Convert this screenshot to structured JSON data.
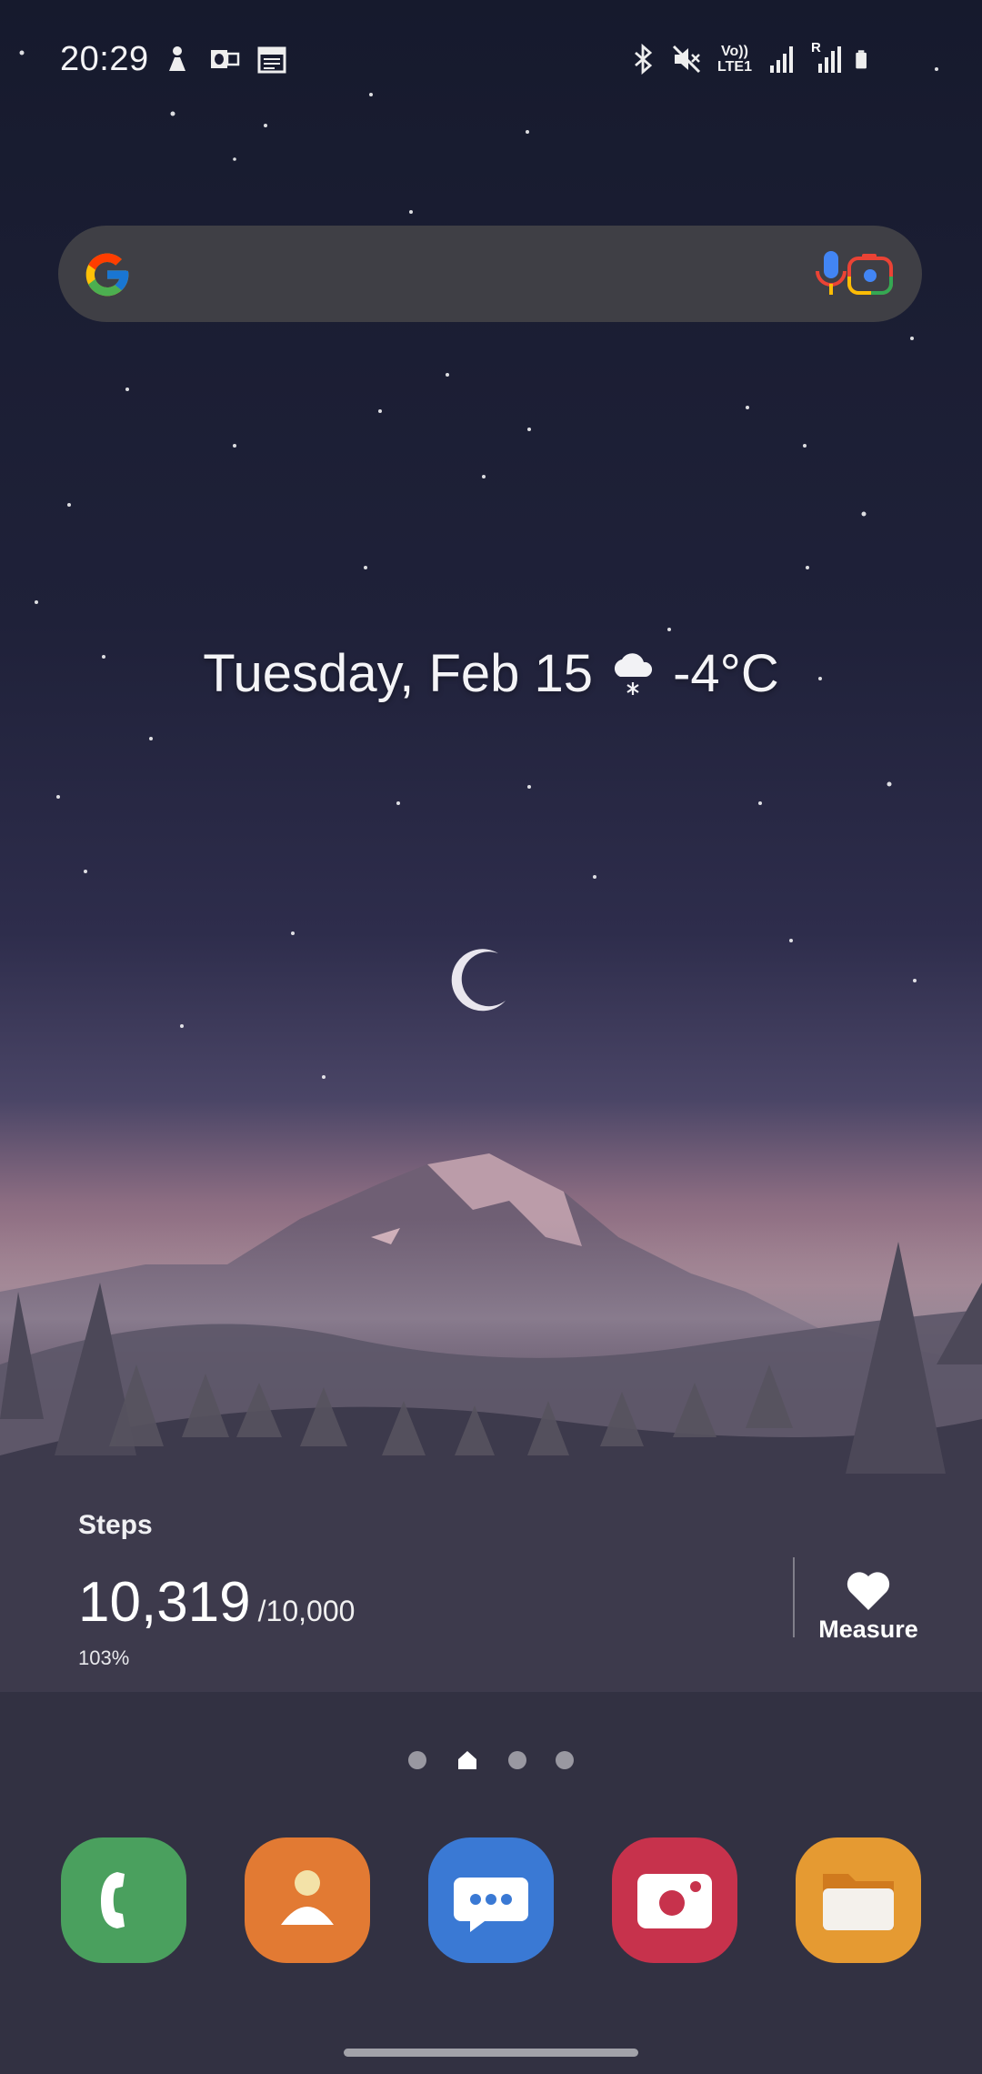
{
  "status_bar": {
    "time": "20:29",
    "left_icons": [
      "notification-person-icon",
      "outlook-icon",
      "calendar-icon"
    ],
    "right_icons": [
      "bluetooth-icon",
      "mute-icon",
      "volte-icon",
      "signal-icon",
      "roaming-signal-icon",
      "battery-icon"
    ],
    "volte_label": "Vo))",
    "lte_label": "LTE1",
    "roaming_label": "R"
  },
  "search": {
    "placeholder": ""
  },
  "date_widget": {
    "date": "Tuesday, Feb 15",
    "weather_icon": "snow-cloud-icon",
    "temperature": "-4°C"
  },
  "steps_widget": {
    "title": "Steps",
    "count": "10,319",
    "goal": "/10,000",
    "percent": "103%",
    "progress_fraction": 1.03,
    "measure_label": "Measure"
  },
  "page_indicator": {
    "pages": 4,
    "current": 2
  },
  "dock": [
    {
      "name": "phone",
      "icon": "phone-icon",
      "color": "#4aa05e"
    },
    {
      "name": "contacts",
      "icon": "contacts-icon",
      "color": "#e27a33"
    },
    {
      "name": "messages",
      "icon": "messages-icon",
      "color": "#3a79d4"
    },
    {
      "name": "screen-recorder",
      "icon": "camera-icon",
      "color": "#c7324c"
    },
    {
      "name": "my-files",
      "icon": "folder-icon",
      "color": "#e59a32"
    }
  ],
  "colors": {
    "sky_top": "#171a2e",
    "sky_mid": "#3b3a5c",
    "horizon": "#b88590",
    "search_bg": "#424246"
  }
}
